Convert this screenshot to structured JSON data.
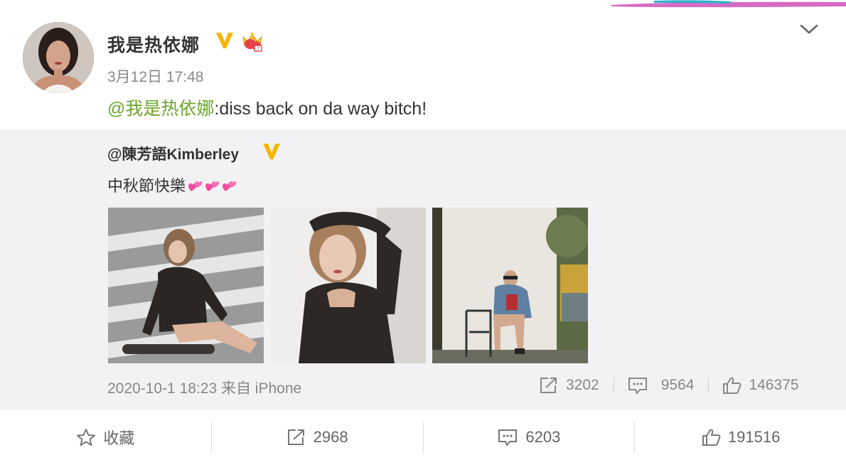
{
  "post": {
    "author": "我是热依娜",
    "time": "3月12日 17:48",
    "mention": "@我是热依娜",
    "text": ":diss back on da way bitch!"
  },
  "retweet": {
    "author": "@陳芳語Kimberley",
    "text": "中秋節快樂",
    "meta": "2020-10-1 18:23 来自 iPhone",
    "stats": {
      "reposts": "3202",
      "comments": "9564",
      "likes": "146375"
    }
  },
  "actions": {
    "favorite": "收藏",
    "reposts": "2968",
    "comments": "6203",
    "likes": "191516"
  },
  "icons": {
    "verified": "verified-v-icon",
    "crown": "crown-badge-icon",
    "menu": "chevron-down-icon",
    "repost": "share-icon",
    "comment": "comment-icon",
    "like": "thumbs-up-icon",
    "favorite": "star-icon"
  },
  "colors": {
    "mention": "#6ea52c",
    "verified": "#f7b500",
    "retweet_bg": "#f2f2f5",
    "meta": "#888888"
  }
}
